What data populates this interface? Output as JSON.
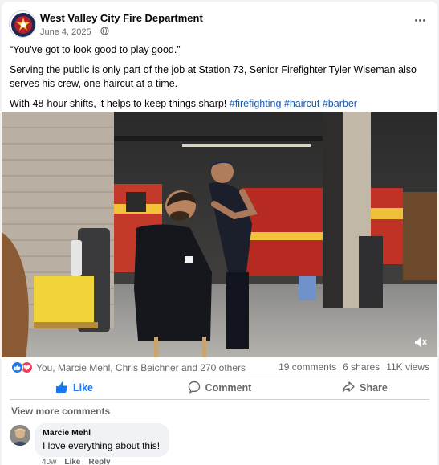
{
  "post": {
    "page_name": "West Valley City Fire Department",
    "date": "June 4, 2025",
    "separator": "·",
    "privacy_icon": "globe-icon",
    "more_icon": "more-options-icon",
    "quote": "“You've got to look good to play good.”",
    "paragraph": "Serving the public is only part of the job at Station 73, Senior Firefighter Tyler Wiseman also serves his crew, one haircut at a time.",
    "closing": "With 48-hour shifts, it helps to keep things sharp!",
    "hashtags": [
      "#firefighting",
      "#haircut",
      "#barber"
    ]
  },
  "media": {
    "type": "video",
    "mute_icon": "muted-speaker-icon"
  },
  "stats": {
    "reaction_icons": [
      "like-icon",
      "love-icon"
    ],
    "reactors": "You, Marcie Mehl, Chris Beichner and 270 others",
    "comments": "19 comments",
    "shares": "6 shares",
    "views": "11K views"
  },
  "actions": {
    "like": "Like",
    "comment": "Comment",
    "share": "Share",
    "liked_color": "#1877f2"
  },
  "comments": {
    "view_more": "View more comments",
    "items": [
      {
        "author": "Marcie Mehl",
        "text": "I love everything about this!",
        "time": "40w",
        "like": "Like",
        "reply": "Reply"
      }
    ]
  }
}
